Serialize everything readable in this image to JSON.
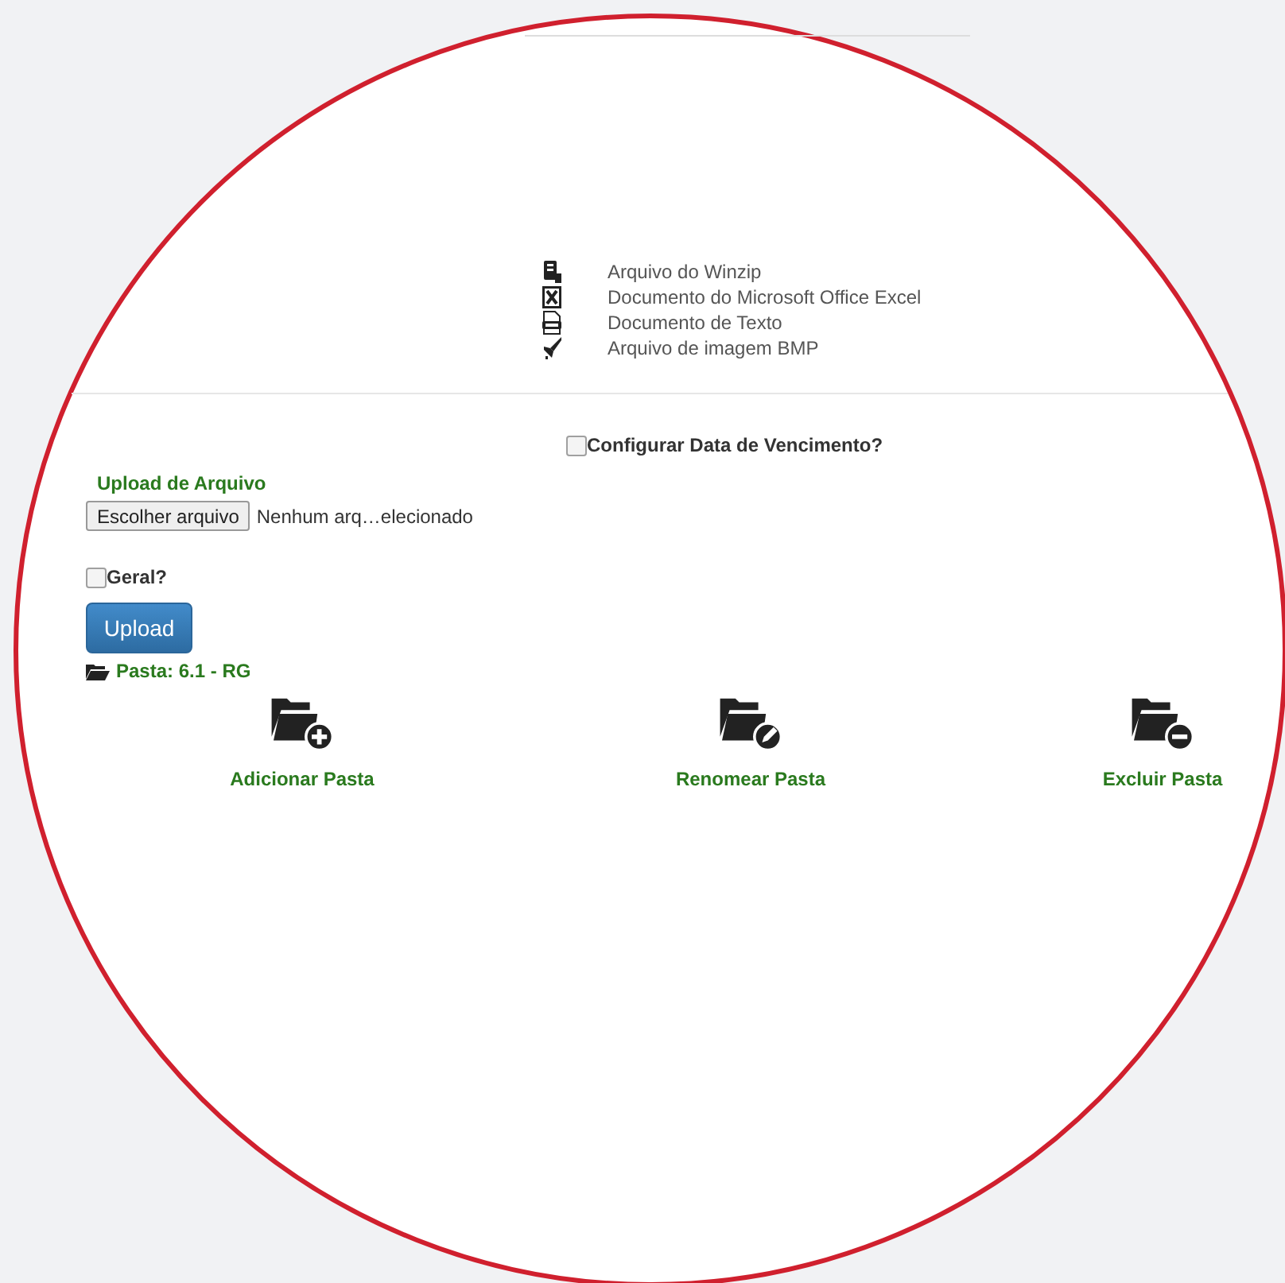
{
  "file_types": [
    {
      "kind": "zip",
      "label": "Arquivo do Winzip"
    },
    {
      "kind": "excel",
      "label": "Documento do Microsoft Office Excel"
    },
    {
      "kind": "text",
      "label": "Documento de Texto"
    },
    {
      "kind": "image",
      "label": "Arquivo de imagem BMP"
    }
  ],
  "due_date_checkbox": {
    "label": "Configurar Data de Vencimento?",
    "checked": false
  },
  "upload": {
    "title": "Upload de Arquivo",
    "choose_button": "Escolher arquivo",
    "file_status": "Nenhum arq…elecionado",
    "general_checkbox": {
      "label": "Geral?",
      "checked": false
    },
    "submit_button": "Upload"
  },
  "folder": {
    "label": "Pasta: 6.1 - RG"
  },
  "actions": [
    {
      "kind": "add",
      "label": "Adicionar Pasta"
    },
    {
      "kind": "rename",
      "label": "Renomear Pasta"
    },
    {
      "kind": "delete",
      "label": "Excluir Pasta"
    }
  ]
}
